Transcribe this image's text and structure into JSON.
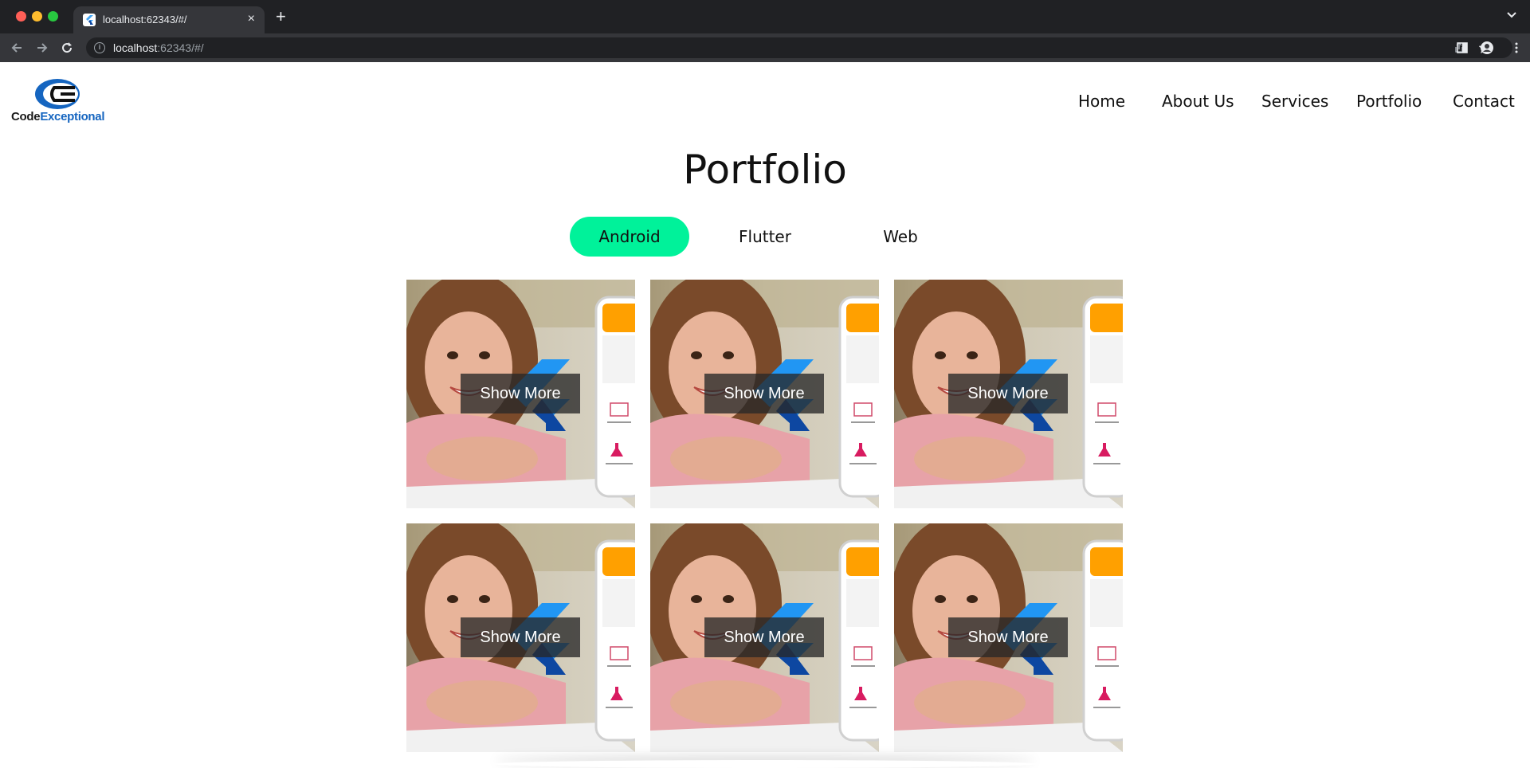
{
  "browser": {
    "tab_title": "localhost:62343/#/",
    "new_tab_symbol": "+",
    "close_symbol": "×",
    "url_host": "localhost",
    "url_rest": ":62343/#/"
  },
  "site": {
    "logo": {
      "part1": "Code",
      "part2": "Exceptional"
    },
    "nav": [
      {
        "label": "Home"
      },
      {
        "label": "About Us"
      },
      {
        "label": "Services"
      },
      {
        "label": "Portfolio"
      },
      {
        "label": "Contact"
      }
    ],
    "title": "Portfolio",
    "filters": [
      {
        "label": "Android",
        "active": true
      },
      {
        "label": "Flutter",
        "active": false
      },
      {
        "label": "Web",
        "active": false
      }
    ],
    "cards": [
      {
        "button": "Show More"
      },
      {
        "button": "Show More"
      },
      {
        "button": "Show More"
      },
      {
        "button": "Show More"
      },
      {
        "button": "Show More"
      },
      {
        "button": "Show More"
      }
    ],
    "accent_color": "#00f29a"
  }
}
